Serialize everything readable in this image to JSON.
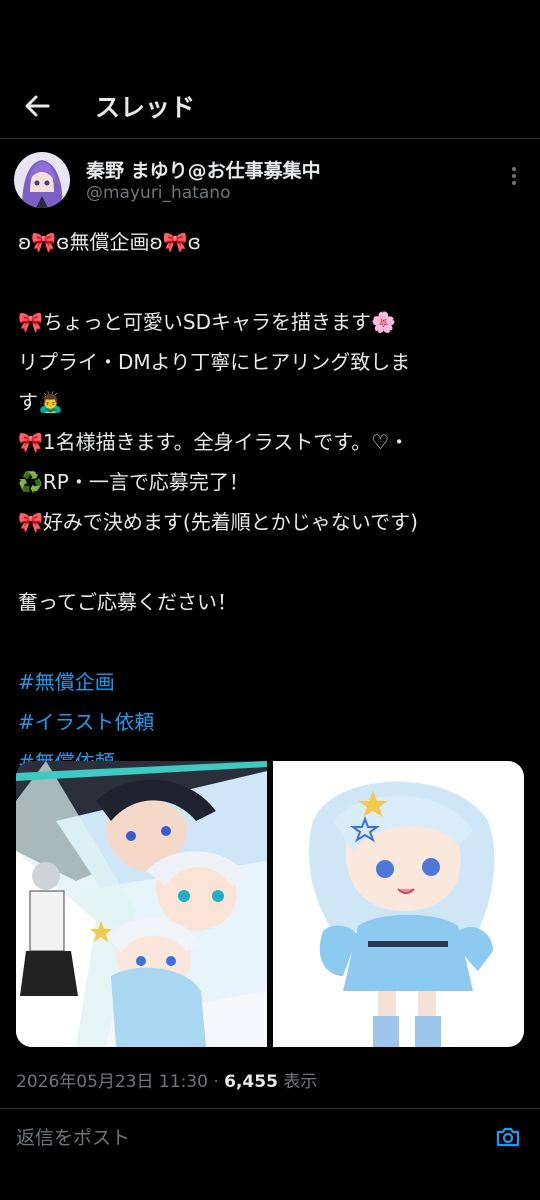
{
  "header": {
    "title": "スレッド",
    "back_icon": "arrow-left-icon"
  },
  "author": {
    "name": "秦野 まゆり@お仕事募集中",
    "handle": "@mayuri_hatano",
    "more_icon": "more-vertical-icon"
  },
  "tweet": {
    "lines": [
      "ʚ🎀ɞ無償企画ʚ🎀ɞ",
      "",
      "🎀ちょっと可愛いSDキャラを描きます🌸",
      "リプライ・DMより丁寧にヒアリング致しま",
      "す🙇‍♂️",
      "🎀1名様描きます。全身イラストです。♡・",
      "♻️RP・一言で応募完了！",
      "🎀好みで決めます(先着順とかじゃないです)",
      "",
      "奮ってご応募ください！",
      ""
    ],
    "hashtags": [
      " #無償企画",
      " #イラスト依頼",
      "#無償依頼"
    ]
  },
  "meta": {
    "datetime": "2026年05月23日 11:30 · ",
    "views_count": "6,455",
    "views_label": " 表示"
  },
  "reply": {
    "placeholder": "返信をポスト",
    "camera_icon": "camera-icon"
  },
  "colors": {
    "background": "#000000",
    "text": "#e7e9ea",
    "muted": "#71767b",
    "accent": "#1d9bf0"
  }
}
